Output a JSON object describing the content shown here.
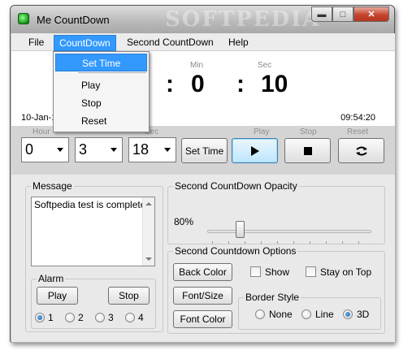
{
  "window": {
    "title": "Me CountDown",
    "watermark": "SOFTPEDIA"
  },
  "menu": {
    "items": [
      "File",
      "CountDown",
      "Second CountDown",
      "Help"
    ],
    "dropdown": [
      "Set Time",
      "Play",
      "Stop",
      "Reset"
    ]
  },
  "display": {
    "min_label": "Min",
    "sec_label": "Sec",
    "colon": ":",
    "minutes": "0",
    "seconds": "10",
    "date": "10-Jan-1",
    "clock": "09:54:20"
  },
  "controls": {
    "faint_labels": [
      "Hour",
      "Sec",
      "Play",
      "Stop",
      "Reset"
    ],
    "hour_value": "0",
    "min_value": "3",
    "sec_value": "18",
    "set_time_label": "Set Time",
    "play_icon": "play-icon",
    "stop_icon": "stop-icon",
    "reset_icon": "reset-icon"
  },
  "message": {
    "title": "Message",
    "text": "Softpedia test is complete!"
  },
  "alarm": {
    "title": "Alarm",
    "play_label": "Play",
    "stop_label": "Stop",
    "options": [
      "1",
      "2",
      "3",
      "4"
    ],
    "selected": "1"
  },
  "opacity": {
    "title": "Second CountDown Opacity",
    "value": "80%",
    "level": 0.2
  },
  "options": {
    "title": "Second Countdown Options",
    "back_color_label": "Back Color",
    "font_size_label": "Font/Size",
    "font_color_label": "Font Color",
    "show_label": "Show",
    "stay_on_top_label": "Stay on Top",
    "border_style_title": "Border Style",
    "border_options": [
      "None",
      "Line",
      "3D"
    ],
    "border_selected": "3D"
  }
}
